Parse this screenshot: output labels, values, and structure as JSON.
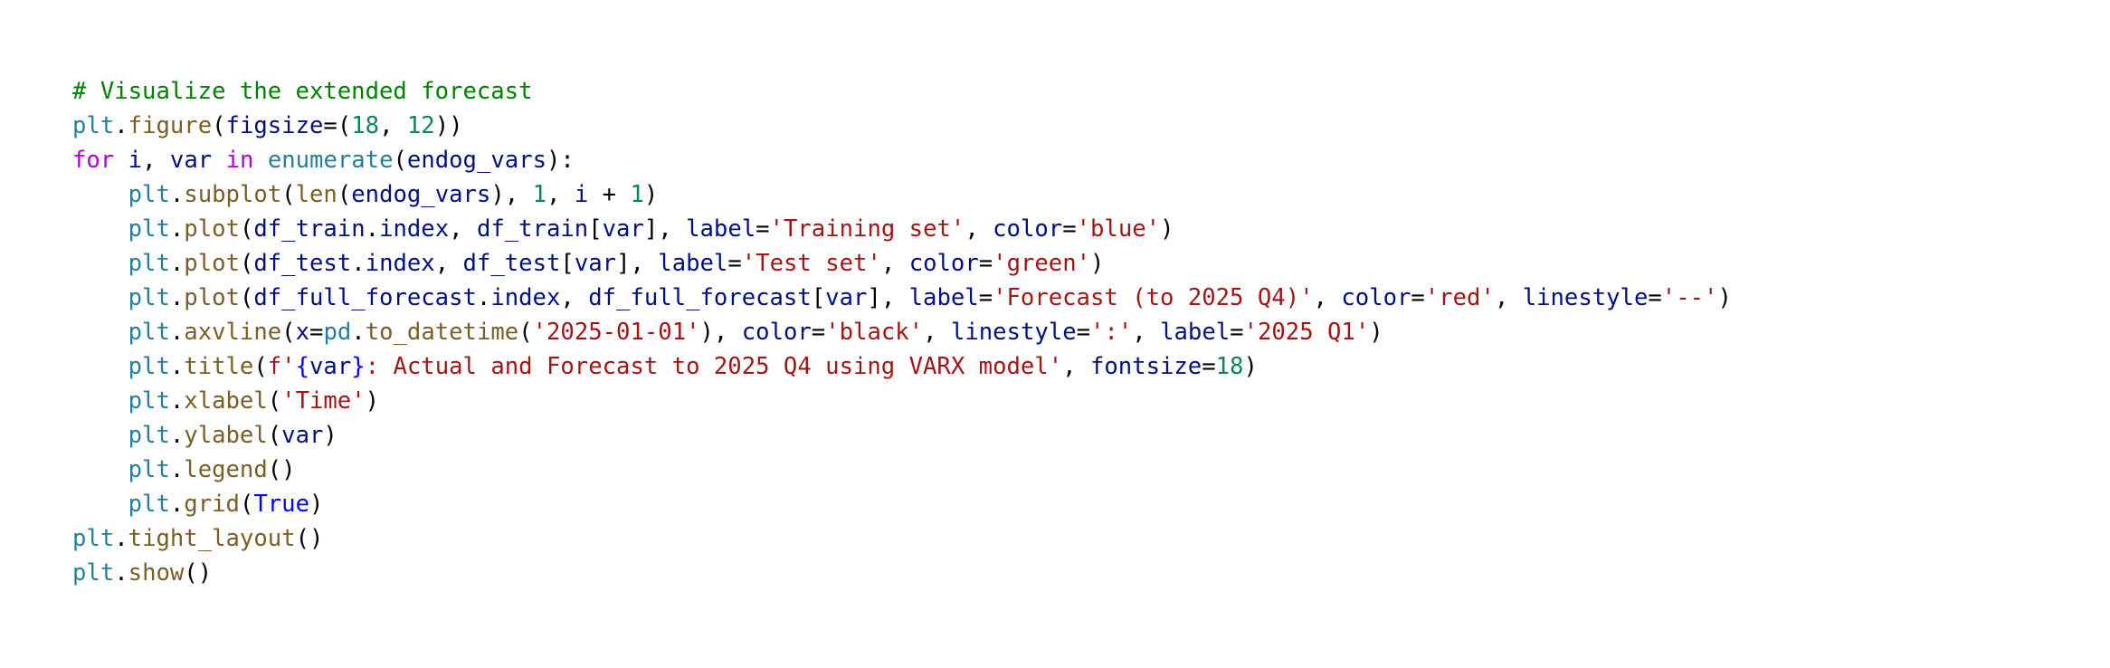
{
  "editor": {
    "colors": {
      "background": "#ffffff",
      "comment": "#008000",
      "function": "#795e26",
      "module": "#267f99",
      "variable": "#001080",
      "keyword": "#af00db",
      "number": "#098658",
      "string": "#a31515",
      "constant": "#0000ff",
      "punctuation": "#000000"
    },
    "lines": [
      [
        {
          "t": "# Visualize the extended forecast",
          "k": "comment"
        }
      ],
      [
        {
          "t": "plt",
          "k": "mod"
        },
        {
          "t": ".",
          "k": "punct"
        },
        {
          "t": "figure",
          "k": "func"
        },
        {
          "t": "(",
          "k": "punct"
        },
        {
          "t": "figsize",
          "k": "var"
        },
        {
          "t": "=(",
          "k": "punct"
        },
        {
          "t": "18",
          "k": "num"
        },
        {
          "t": ", ",
          "k": "punct"
        },
        {
          "t": "12",
          "k": "num"
        },
        {
          "t": "))",
          "k": "punct"
        }
      ],
      [
        {
          "t": "for",
          "k": "kw"
        },
        {
          "t": " ",
          "k": "punct"
        },
        {
          "t": "i",
          "k": "var"
        },
        {
          "t": ", ",
          "k": "punct"
        },
        {
          "t": "var",
          "k": "var"
        },
        {
          "t": " ",
          "k": "punct"
        },
        {
          "t": "in",
          "k": "kw"
        },
        {
          "t": " ",
          "k": "punct"
        },
        {
          "t": "enumerate",
          "k": "mod"
        },
        {
          "t": "(",
          "k": "punct"
        },
        {
          "t": "endog_vars",
          "k": "var"
        },
        {
          "t": "):",
          "k": "punct"
        }
      ],
      [
        {
          "t": "    ",
          "k": "punct"
        },
        {
          "t": "plt",
          "k": "mod"
        },
        {
          "t": ".",
          "k": "punct"
        },
        {
          "t": "subplot",
          "k": "func"
        },
        {
          "t": "(",
          "k": "punct"
        },
        {
          "t": "len",
          "k": "func"
        },
        {
          "t": "(",
          "k": "punct"
        },
        {
          "t": "endog_vars",
          "k": "var"
        },
        {
          "t": "), ",
          "k": "punct"
        },
        {
          "t": "1",
          "k": "num"
        },
        {
          "t": ", ",
          "k": "punct"
        },
        {
          "t": "i",
          "k": "var"
        },
        {
          "t": " + ",
          "k": "punct"
        },
        {
          "t": "1",
          "k": "num"
        },
        {
          "t": ")",
          "k": "punct"
        }
      ],
      [
        {
          "t": "    ",
          "k": "punct"
        },
        {
          "t": "plt",
          "k": "mod"
        },
        {
          "t": ".",
          "k": "punct"
        },
        {
          "t": "plot",
          "k": "func"
        },
        {
          "t": "(",
          "k": "punct"
        },
        {
          "t": "df_train",
          "k": "var"
        },
        {
          "t": ".",
          "k": "punct"
        },
        {
          "t": "index",
          "k": "var"
        },
        {
          "t": ", ",
          "k": "punct"
        },
        {
          "t": "df_train",
          "k": "var"
        },
        {
          "t": "[",
          "k": "punct"
        },
        {
          "t": "var",
          "k": "var"
        },
        {
          "t": "], ",
          "k": "punct"
        },
        {
          "t": "label",
          "k": "var"
        },
        {
          "t": "=",
          "k": "punct"
        },
        {
          "t": "'Training set'",
          "k": "str"
        },
        {
          "t": ", ",
          "k": "punct"
        },
        {
          "t": "color",
          "k": "var"
        },
        {
          "t": "=",
          "k": "punct"
        },
        {
          "t": "'blue'",
          "k": "str"
        },
        {
          "t": ")",
          "k": "punct"
        }
      ],
      [
        {
          "t": "    ",
          "k": "punct"
        },
        {
          "t": "plt",
          "k": "mod"
        },
        {
          "t": ".",
          "k": "punct"
        },
        {
          "t": "plot",
          "k": "func"
        },
        {
          "t": "(",
          "k": "punct"
        },
        {
          "t": "df_test",
          "k": "var"
        },
        {
          "t": ".",
          "k": "punct"
        },
        {
          "t": "index",
          "k": "var"
        },
        {
          "t": ", ",
          "k": "punct"
        },
        {
          "t": "df_test",
          "k": "var"
        },
        {
          "t": "[",
          "k": "punct"
        },
        {
          "t": "var",
          "k": "var"
        },
        {
          "t": "], ",
          "k": "punct"
        },
        {
          "t": "label",
          "k": "var"
        },
        {
          "t": "=",
          "k": "punct"
        },
        {
          "t": "'Test set'",
          "k": "str"
        },
        {
          "t": ", ",
          "k": "punct"
        },
        {
          "t": "color",
          "k": "var"
        },
        {
          "t": "=",
          "k": "punct"
        },
        {
          "t": "'green'",
          "k": "str"
        },
        {
          "t": ")",
          "k": "punct"
        }
      ],
      [
        {
          "t": "    ",
          "k": "punct"
        },
        {
          "t": "plt",
          "k": "mod"
        },
        {
          "t": ".",
          "k": "punct"
        },
        {
          "t": "plot",
          "k": "func"
        },
        {
          "t": "(",
          "k": "punct"
        },
        {
          "t": "df_full_forecast",
          "k": "var"
        },
        {
          "t": ".",
          "k": "punct"
        },
        {
          "t": "index",
          "k": "var"
        },
        {
          "t": ", ",
          "k": "punct"
        },
        {
          "t": "df_full_forecast",
          "k": "var"
        },
        {
          "t": "[",
          "k": "punct"
        },
        {
          "t": "var",
          "k": "var"
        },
        {
          "t": "], ",
          "k": "punct"
        },
        {
          "t": "label",
          "k": "var"
        },
        {
          "t": "=",
          "k": "punct"
        },
        {
          "t": "'Forecast (to 2025 Q4)'",
          "k": "str"
        },
        {
          "t": ", ",
          "k": "punct"
        },
        {
          "t": "color",
          "k": "var"
        },
        {
          "t": "=",
          "k": "punct"
        },
        {
          "t": "'red'",
          "k": "str"
        },
        {
          "t": ", ",
          "k": "punct"
        },
        {
          "t": "linestyle",
          "k": "var"
        },
        {
          "t": "=",
          "k": "punct"
        },
        {
          "t": "'--'",
          "k": "str"
        },
        {
          "t": ")",
          "k": "punct"
        }
      ],
      [
        {
          "t": "    ",
          "k": "punct"
        },
        {
          "t": "plt",
          "k": "mod"
        },
        {
          "t": ".",
          "k": "punct"
        },
        {
          "t": "axvline",
          "k": "func"
        },
        {
          "t": "(",
          "k": "punct"
        },
        {
          "t": "x",
          "k": "var"
        },
        {
          "t": "=",
          "k": "punct"
        },
        {
          "t": "pd",
          "k": "mod"
        },
        {
          "t": ".",
          "k": "punct"
        },
        {
          "t": "to_datetime",
          "k": "func"
        },
        {
          "t": "(",
          "k": "punct"
        },
        {
          "t": "'2025-01-01'",
          "k": "str"
        },
        {
          "t": "), ",
          "k": "punct"
        },
        {
          "t": "color",
          "k": "var"
        },
        {
          "t": "=",
          "k": "punct"
        },
        {
          "t": "'black'",
          "k": "str"
        },
        {
          "t": ", ",
          "k": "punct"
        },
        {
          "t": "linestyle",
          "k": "var"
        },
        {
          "t": "=",
          "k": "punct"
        },
        {
          "t": "':'",
          "k": "str"
        },
        {
          "t": ", ",
          "k": "punct"
        },
        {
          "t": "label",
          "k": "var"
        },
        {
          "t": "=",
          "k": "punct"
        },
        {
          "t": "'2025 Q1'",
          "k": "str"
        },
        {
          "t": ")",
          "k": "punct"
        }
      ],
      [
        {
          "t": "    ",
          "k": "punct"
        },
        {
          "t": "plt",
          "k": "mod"
        },
        {
          "t": ".",
          "k": "punct"
        },
        {
          "t": "title",
          "k": "func"
        },
        {
          "t": "(",
          "k": "punct"
        },
        {
          "t": "f'",
          "k": "str"
        },
        {
          "t": "{",
          "k": "const"
        },
        {
          "t": "var",
          "k": "var"
        },
        {
          "t": "}",
          "k": "const"
        },
        {
          "t": ": Actual and Forecast to 2025 Q4 using VARX model'",
          "k": "str"
        },
        {
          "t": ", ",
          "k": "punct"
        },
        {
          "t": "fontsize",
          "k": "var"
        },
        {
          "t": "=",
          "k": "punct"
        },
        {
          "t": "18",
          "k": "num"
        },
        {
          "t": ")",
          "k": "punct"
        }
      ],
      [
        {
          "t": "    ",
          "k": "punct"
        },
        {
          "t": "plt",
          "k": "mod"
        },
        {
          "t": ".",
          "k": "punct"
        },
        {
          "t": "xlabel",
          "k": "func"
        },
        {
          "t": "(",
          "k": "punct"
        },
        {
          "t": "'Time'",
          "k": "str"
        },
        {
          "t": ")",
          "k": "punct"
        }
      ],
      [
        {
          "t": "    ",
          "k": "punct"
        },
        {
          "t": "plt",
          "k": "mod"
        },
        {
          "t": ".",
          "k": "punct"
        },
        {
          "t": "ylabel",
          "k": "func"
        },
        {
          "t": "(",
          "k": "punct"
        },
        {
          "t": "var",
          "k": "var"
        },
        {
          "t": ")",
          "k": "punct"
        }
      ],
      [
        {
          "t": "    ",
          "k": "punct"
        },
        {
          "t": "plt",
          "k": "mod"
        },
        {
          "t": ".",
          "k": "punct"
        },
        {
          "t": "legend",
          "k": "func"
        },
        {
          "t": "()",
          "k": "punct"
        }
      ],
      [
        {
          "t": "    ",
          "k": "punct"
        },
        {
          "t": "plt",
          "k": "mod"
        },
        {
          "t": ".",
          "k": "punct"
        },
        {
          "t": "grid",
          "k": "func"
        },
        {
          "t": "(",
          "k": "punct"
        },
        {
          "t": "True",
          "k": "const"
        },
        {
          "t": ")",
          "k": "punct"
        }
      ],
      [
        {
          "t": "plt",
          "k": "mod"
        },
        {
          "t": ".",
          "k": "punct"
        },
        {
          "t": "tight_layout",
          "k": "func"
        },
        {
          "t": "()",
          "k": "punct"
        }
      ],
      [
        {
          "t": "plt",
          "k": "mod"
        },
        {
          "t": ".",
          "k": "punct"
        },
        {
          "t": "show",
          "k": "func"
        },
        {
          "t": "()",
          "k": "punct"
        }
      ]
    ]
  }
}
